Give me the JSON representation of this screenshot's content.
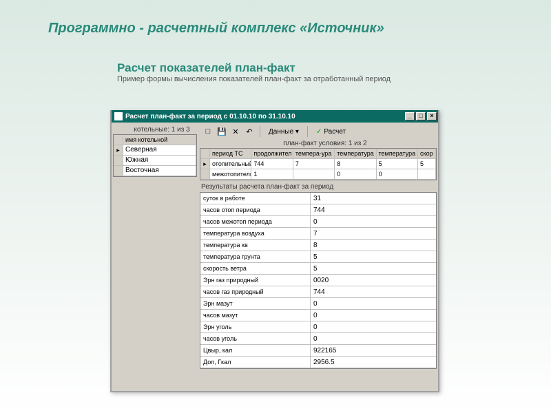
{
  "page": {
    "title": "Программно - расчетный комплекс «Источник»",
    "section_title": "Расчет показателей план-факт",
    "section_sub": "Пример формы вычисления показателей план-факт за отработанный период"
  },
  "window": {
    "title": "Расчет план-факт за период с 01.10.10 по 31.10.10",
    "btn_min": "_",
    "btn_max": "□",
    "btn_close": "×"
  },
  "left_grid": {
    "counter": "котельные: 1 из 3",
    "header": "имя котельной",
    "rows": [
      "Северная",
      "Южная",
      "Восточная"
    ]
  },
  "toolbar": {
    "new_icon": "□",
    "save_icon": "💾",
    "delete_icon": "✕",
    "undo_icon": "↶",
    "data_label": "Данные ▾",
    "calc_icon": "✓",
    "calc_label": "Расчет"
  },
  "tc_grid": {
    "counter": "план-факт условия: 1 из 2",
    "headers": [
      "период ТС",
      "продолжител",
      "темпера-ура",
      "температура",
      "температура",
      "скор"
    ],
    "rows": [
      [
        "отопительный",
        "744",
        "7",
        "8",
        "5",
        "5"
      ],
      [
        "межотопительный",
        "1",
        "",
        "0",
        "0",
        ""
      ]
    ]
  },
  "results": {
    "label": "Результаты расчета план-факт за период",
    "fields": [
      {
        "name": "суток в работе",
        "value": "31"
      },
      {
        "name": "часов отоп периода",
        "value": "744"
      },
      {
        "name": "часов межотоп периода",
        "value": "0"
      },
      {
        "name": "температура воздуха",
        "value": "7"
      },
      {
        "name": "температура кв",
        "value": "8"
      },
      {
        "name": "температура грунта",
        "value": "5"
      },
      {
        "name": "скорость ветра",
        "value": "5"
      },
      {
        "name": "Эрн газ природный",
        "value": "0020"
      },
      {
        "name": "часов газ природный",
        "value": "744"
      },
      {
        "name": "Эрн мазут",
        "value": "0"
      },
      {
        "name": "часов мазут",
        "value": "0"
      },
      {
        "name": "Эрн уголь",
        "value": "0"
      },
      {
        "name": "часов уголь",
        "value": "0"
      },
      {
        "name": "Цвыр, кал",
        "value": "922165"
      },
      {
        "name": "Доп, Гкал",
        "value": "2956.5"
      }
    ]
  }
}
